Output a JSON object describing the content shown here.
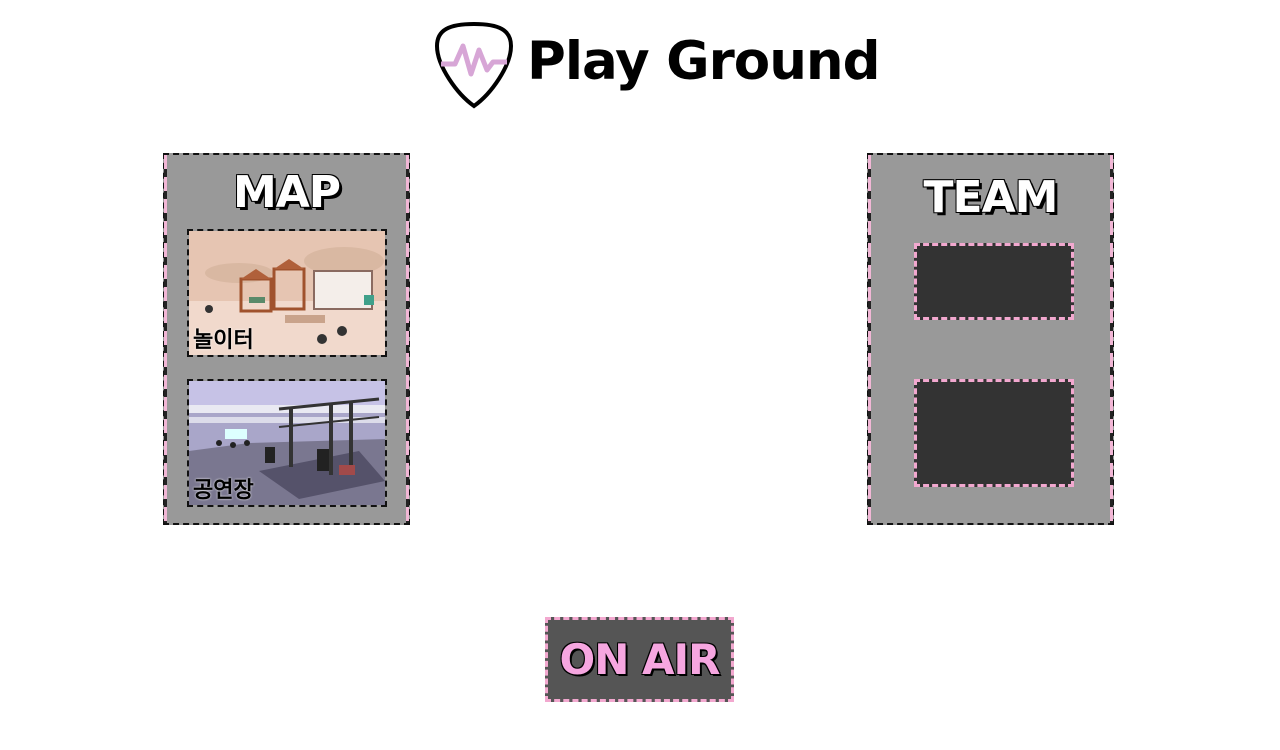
{
  "header": {
    "title": "Play Ground",
    "logo_icon": "pick-heartbeat-icon",
    "accent_color": "#d7a6d6"
  },
  "map_panel": {
    "title": "MAP",
    "items": [
      {
        "label": "놀이터",
        "thumbnail": "playground-scene"
      },
      {
        "label": "공연장",
        "thumbnail": "concert-hall-scene"
      }
    ]
  },
  "team_panel": {
    "title": "TEAM",
    "slots": 2
  },
  "actions": {
    "on_air_label": "ON AIR"
  },
  "colors": {
    "panel_bg": "#999999",
    "slot_bg": "#333333",
    "dash_pink": "#f2a8cf",
    "on_air_text": "#f6a6e0"
  }
}
